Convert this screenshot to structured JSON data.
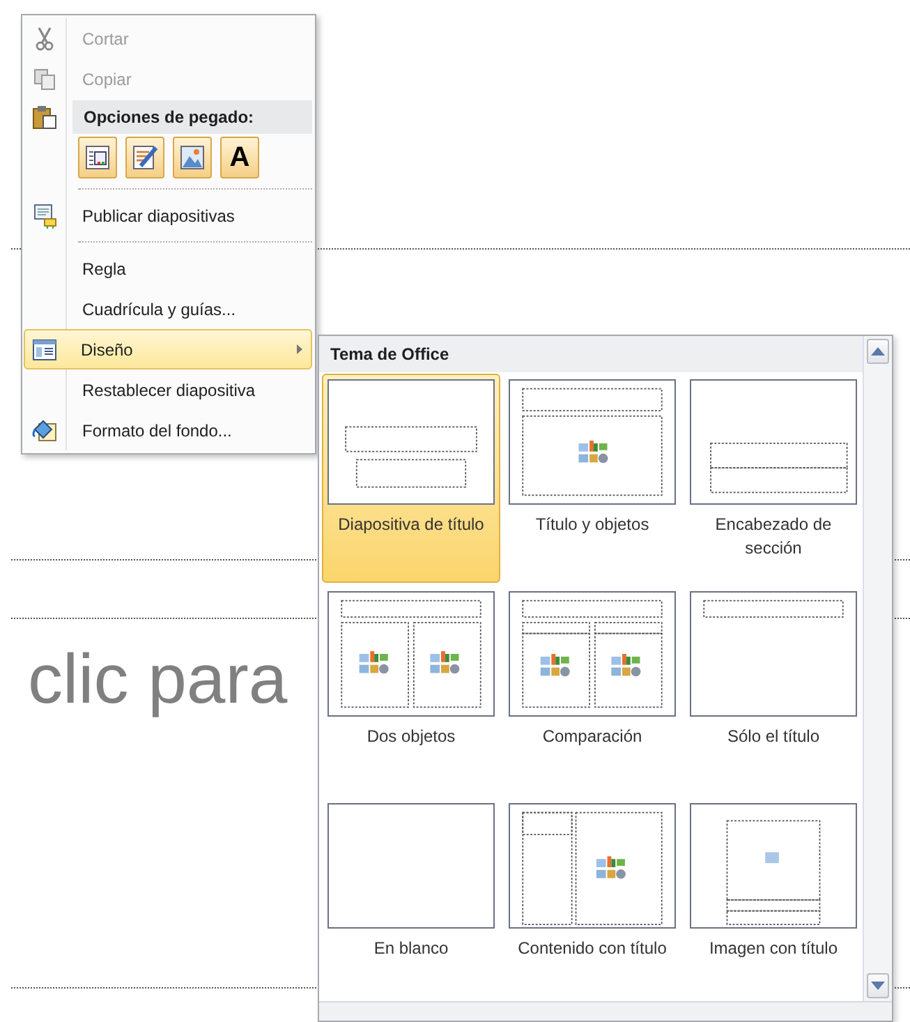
{
  "slide": {
    "body_text": "clic para"
  },
  "context_menu": {
    "sections": [
      {
        "items": [
          {
            "kind": "item",
            "label": "Cortar",
            "disabled": true
          },
          {
            "kind": "item",
            "label": "Copiar",
            "disabled": true
          },
          {
            "kind": "header",
            "label": "Opciones de pegado:"
          },
          {
            "kind": "paste",
            "options": [
              {
                "kind": "keep"
              },
              {
                "kind": "theme"
              },
              {
                "kind": "picture"
              },
              {
                "kind": "text",
                "label": "A"
              }
            ]
          }
        ]
      },
      {
        "items": [
          {
            "kind": "item",
            "label": "Publicar diapositivas",
            "disabled": false
          }
        ]
      },
      {
        "items": [
          {
            "kind": "item",
            "label": "Regla",
            "disabled": false
          },
          {
            "kind": "item",
            "label": "Cuadrícula y guías...",
            "disabled": false
          },
          {
            "kind": "submenu",
            "label": "Diseño",
            "selected": true
          },
          {
            "kind": "item",
            "label": "Restablecer diapositiva",
            "disabled": false
          },
          {
            "kind": "item",
            "label": "Formato del fondo...",
            "disabled": false
          }
        ]
      }
    ]
  },
  "layout_gallery": {
    "title": "Tema de Office",
    "layouts": [
      {
        "kind": "title",
        "label": "Diapositiva de título",
        "selected": true
      },
      {
        "kind": "title-content",
        "label": "Título y objetos",
        "selected": false
      },
      {
        "kind": "section",
        "label": "Encabezado de sección",
        "selected": false
      },
      {
        "kind": "two-content",
        "label": "Dos objetos",
        "selected": false
      },
      {
        "kind": "comparison",
        "label": "Comparación",
        "selected": false
      },
      {
        "kind": "title-only",
        "label": "Sólo el título",
        "selected": false
      },
      {
        "kind": "blank",
        "label": "En blanco",
        "selected": false
      },
      {
        "kind": "content-caption",
        "label": "Contenido con título",
        "selected": false
      },
      {
        "kind": "picture-caption",
        "label": "Imagen con título",
        "selected": false
      }
    ]
  }
}
